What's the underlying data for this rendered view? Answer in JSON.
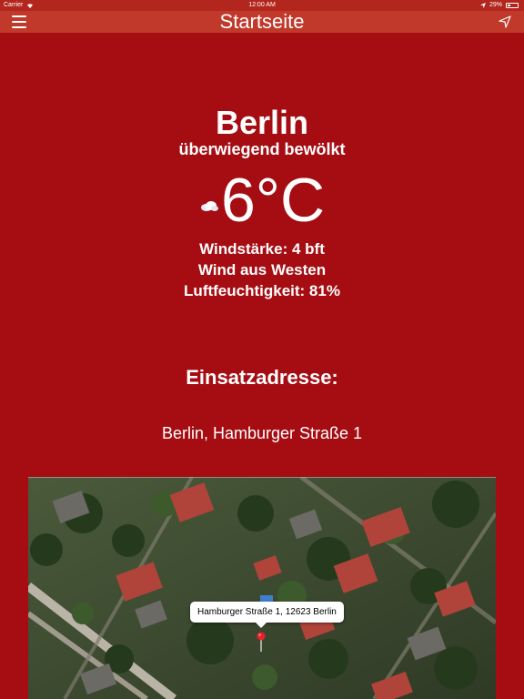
{
  "status_bar": {
    "carrier": "Carrier",
    "time": "12:00 AM",
    "battery": "29%",
    "battery_level": 0.29
  },
  "nav": {
    "title": "Startseite",
    "menu_icon": "hamburger-menu-icon",
    "location_icon": "location-arrow-icon"
  },
  "weather": {
    "city": "Berlin",
    "condition": "überwiegend bewölkt",
    "icon": "cloud-icon",
    "temperature": "6°C",
    "wind_strength": "Windstärke: 4 bft",
    "wind_direction": "Wind aus Westen",
    "humidity": "Luftfeuchtigkeit: 81%"
  },
  "address": {
    "heading": "Einsatzadresse:",
    "value": "Berlin, Hamburger Straße 1"
  },
  "map": {
    "callout": "Hamburger Straße 1, 12623 Berlin",
    "pin_icon": "map-pin-icon"
  },
  "colors": {
    "background": "#a50d13",
    "navbar": "#c0392b",
    "text": "#ffffff"
  }
}
